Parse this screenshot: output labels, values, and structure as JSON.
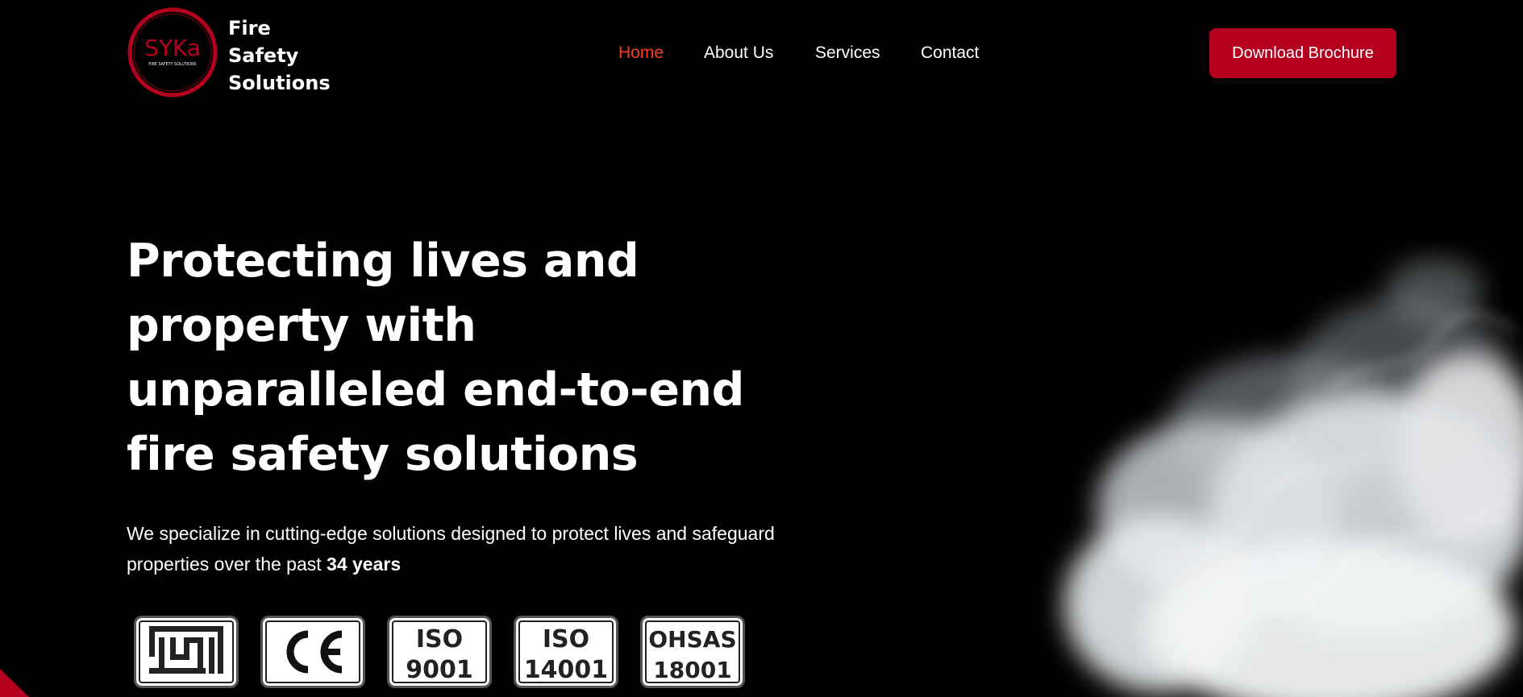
{
  "header": {
    "logo": {
      "mark_text": "SYKa",
      "mark_subtext": "FIRE SAFETY SOLUTIONS",
      "name_lines": [
        "Fire",
        "Safety",
        "Solutions"
      ]
    },
    "nav": [
      {
        "label": "Home",
        "active": true
      },
      {
        "label": "About Us",
        "active": false
      },
      {
        "label": "Services",
        "active": false
      },
      {
        "label": "Contact",
        "active": false
      }
    ],
    "cta_label": "Download Brochure"
  },
  "hero": {
    "title": "Protecting lives and property with unparalleled end-to-end fire safety solutions",
    "subtitle_prefix": "We specialize in cutting-edge solutions designed to protect lives and safeguard properties over the past ",
    "subtitle_highlight": "34 years"
  },
  "badges": [
    {
      "name": "ISI",
      "lines": []
    },
    {
      "name": "CE",
      "lines": []
    },
    {
      "name": "ISO 9001",
      "lines": [
        "ISO",
        "9001"
      ]
    },
    {
      "name": "ISO 14001",
      "lines": [
        "ISO",
        "14001"
      ]
    },
    {
      "name": "OHSAS 18001",
      "lines": [
        "OHSAS",
        "18001"
      ]
    }
  ],
  "colors": {
    "background": "#000000",
    "accent_red": "#b4001e",
    "nav_active": "#ff3b22",
    "text": "#ffffff"
  },
  "icons": {
    "logo": "syka-ring-logo",
    "isi": "isi-mark-icon",
    "ce": "ce-mark-icon",
    "smoke": "smoke-cloud-image"
  }
}
